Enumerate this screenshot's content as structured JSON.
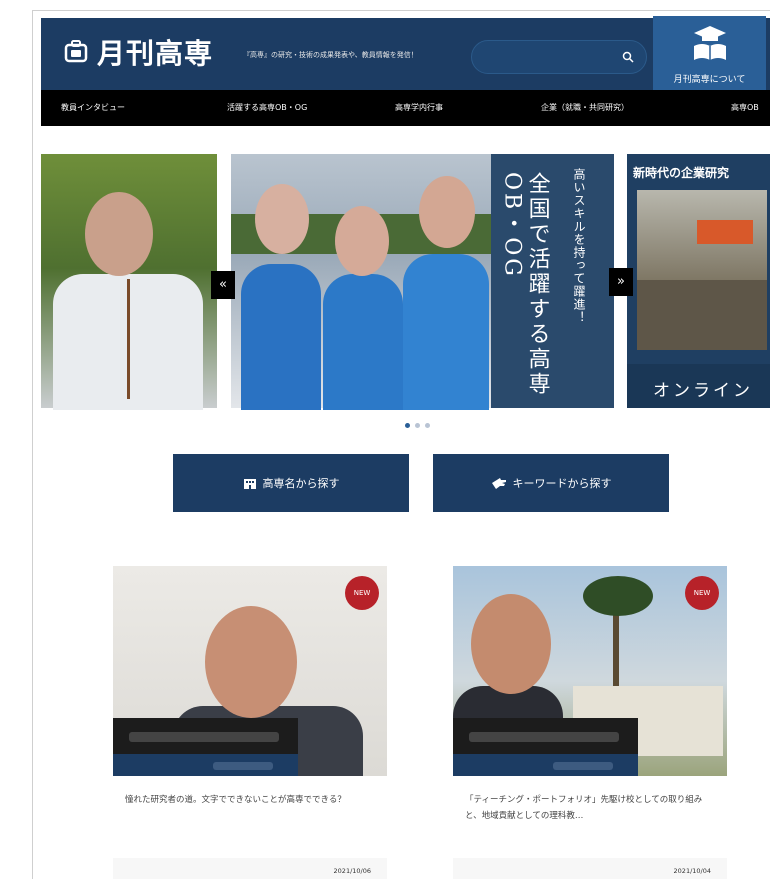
{
  "header": {
    "logo_text": "月刊高専",
    "tagline": "『高専』の研究・技術の成果発表や、教員情報を発信！",
    "search_placeholder": "",
    "about_label": "月刊高専について"
  },
  "nav": {
    "items": [
      "教員インタビュー",
      "活躍する高専OB・OG",
      "高専学内行事",
      "企業（就職・共同研究）",
      "高専OB"
    ]
  },
  "hero": {
    "slide_b_title": "全国で活躍する高専OB・OG",
    "slide_b_subtitle": "高いスキルを持って躍進！",
    "slide_c_title": "新時代の企業研究",
    "slide_c_subtitle": "オンライン"
  },
  "carousel_prev": "«",
  "carousel_next": "»",
  "buttons": {
    "by_school": "高専名から探す",
    "by_keyword": "キーワードから探す"
  },
  "cards": [
    {
      "badge": "NEW",
      "excerpt": "憧れた研究者の道。文字でできないことが高専でできる？",
      "date": "2021/10/06"
    },
    {
      "badge": "NEW",
      "excerpt": "「ティーチング・ポートフォリオ」先駆け校としての取り組みと、地域貢献としての理科教…",
      "date": "2021/10/04"
    }
  ],
  "colors": {
    "primary": "#1c3c63",
    "accent": "#2a5f97",
    "badge": "#b72229"
  }
}
